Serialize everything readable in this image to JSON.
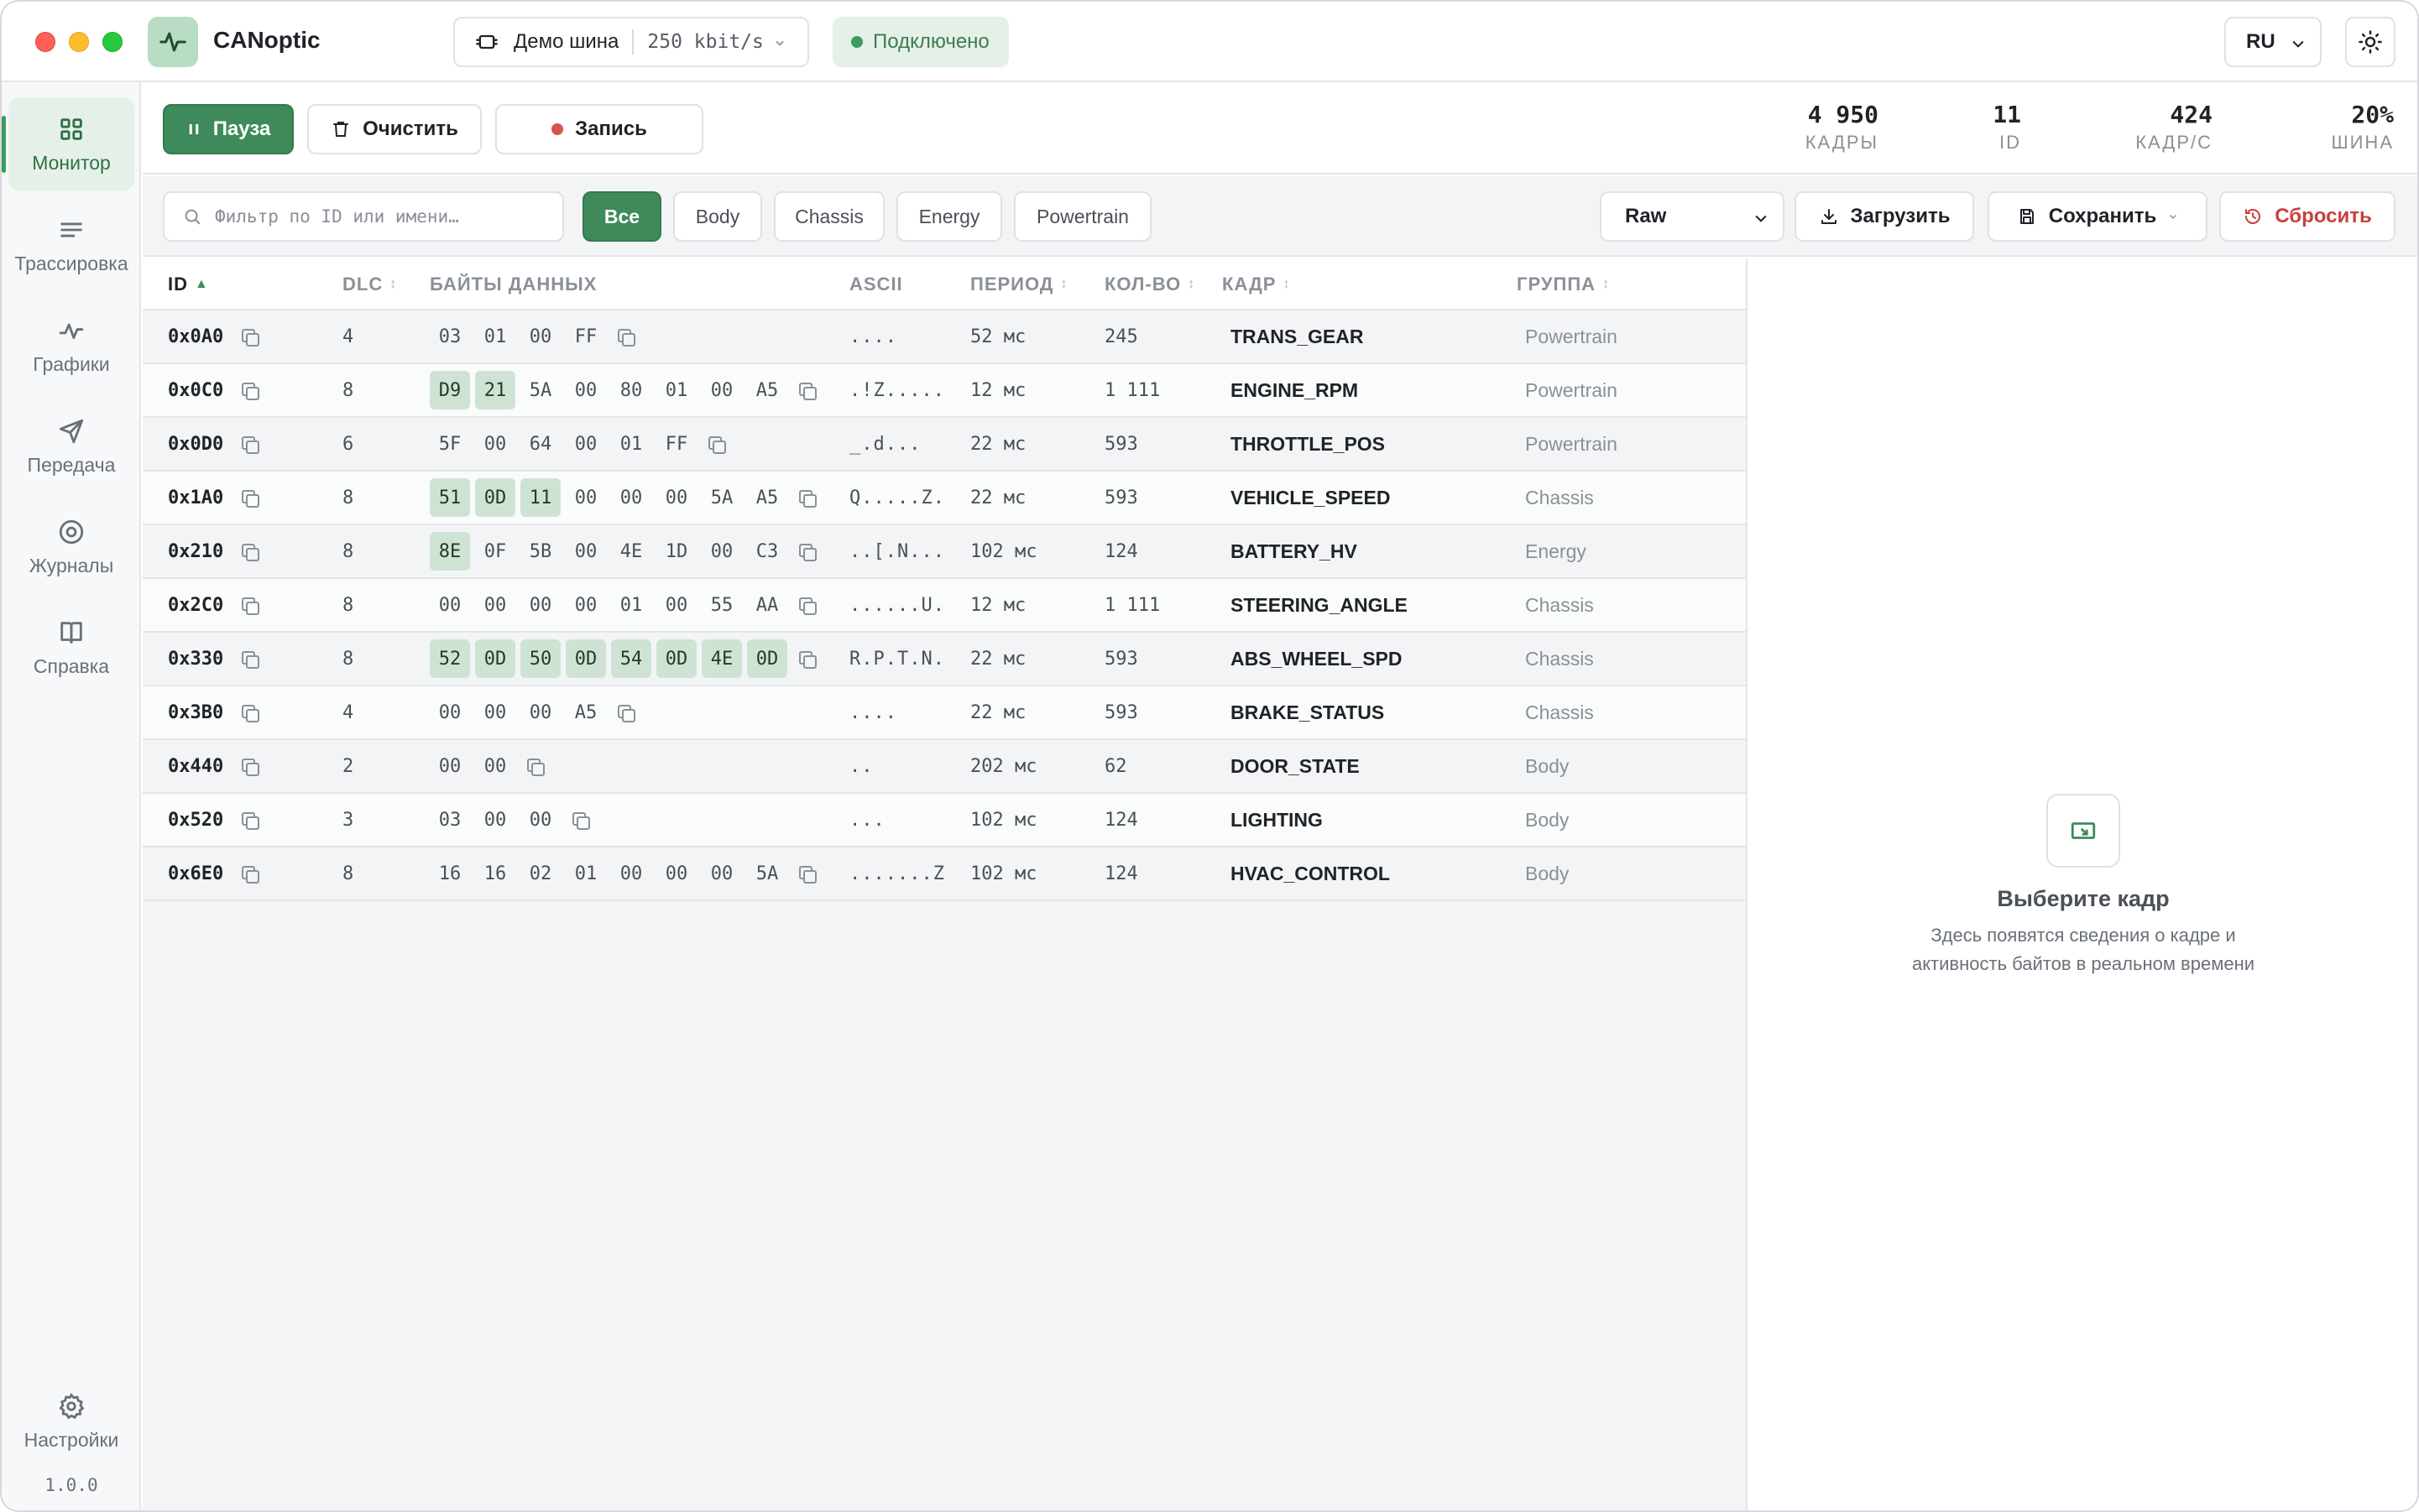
{
  "app": {
    "title": "CANoptic",
    "version": "1.0.0"
  },
  "bus": {
    "name": "Демо шина",
    "bitrate": "250 kbit/s"
  },
  "connection": {
    "status": "Подключено",
    "color": "#3f9a5e"
  },
  "language": "RU",
  "nav": {
    "items": [
      {
        "label": "Монитор",
        "icon": "grid-icon",
        "active": true
      },
      {
        "label": "Трассировка",
        "icon": "list-lines-icon"
      },
      {
        "label": "Графики",
        "icon": "pulse-icon"
      },
      {
        "label": "Передача",
        "icon": "send-icon"
      },
      {
        "label": "Журналы",
        "icon": "record-circle-icon"
      },
      {
        "label": "Справка",
        "icon": "book-icon"
      }
    ],
    "settings_label": "Настройки"
  },
  "toolbar": {
    "pause_label": "Пауза",
    "clear_label": "Очистить",
    "record_label": "Запись"
  },
  "stats": [
    {
      "value": "4 950",
      "label": "КАДРЫ"
    },
    {
      "value": "11",
      "label": "ID"
    },
    {
      "value": "424",
      "label": "КАДР/С"
    },
    {
      "value": "20%",
      "label": "ШИНА"
    }
  ],
  "filter": {
    "placeholder": "Фильтр по ID или имени…",
    "chips": [
      "Все",
      "Body",
      "Chassis",
      "Energy",
      "Powertrain"
    ],
    "active_chip": "Все",
    "mode": "Raw",
    "load_label": "Загрузить",
    "save_label": "Сохранить",
    "reset_label": "Сбросить"
  },
  "table": {
    "columns": {
      "id": "ID",
      "dlc": "DLC",
      "bytes": "БАЙТЫ ДАННЫХ",
      "ascii": "ASCII",
      "period": "ПЕРИОД",
      "count": "КОЛ-ВО",
      "frame": "КАДР",
      "group": "ГРУППА"
    },
    "sort": {
      "column": "ID",
      "direction": "asc"
    },
    "rows": [
      {
        "id": "0x0A0",
        "dlc": "4",
        "bytes": [
          "03",
          "01",
          "00",
          "FF"
        ],
        "changed": [],
        "ascii": "....",
        "period": "52 мс",
        "count": "245",
        "frame": "TRANS_GEAR",
        "group": "Powertrain"
      },
      {
        "id": "0x0C0",
        "dlc": "8",
        "bytes": [
          "D9",
          "21",
          "5A",
          "00",
          "80",
          "01",
          "00",
          "A5"
        ],
        "changed": [
          0,
          1
        ],
        "ascii": ".!Z.....",
        "period": "12 мс",
        "count": "1 111",
        "frame": "ENGINE_RPM",
        "group": "Powertrain"
      },
      {
        "id": "0x0D0",
        "dlc": "6",
        "bytes": [
          "5F",
          "00",
          "64",
          "00",
          "01",
          "FF"
        ],
        "changed": [],
        "ascii": "_.d...",
        "period": "22 мс",
        "count": "593",
        "frame": "THROTTLE_POS",
        "group": "Powertrain"
      },
      {
        "id": "0x1A0",
        "dlc": "8",
        "bytes": [
          "51",
          "0D",
          "11",
          "00",
          "00",
          "00",
          "5A",
          "A5"
        ],
        "changed": [
          0,
          1,
          2
        ],
        "ascii": "Q.....Z.",
        "period": "22 мс",
        "count": "593",
        "frame": "VEHICLE_SPEED",
        "group": "Chassis"
      },
      {
        "id": "0x210",
        "dlc": "8",
        "bytes": [
          "8E",
          "0F",
          "5B",
          "00",
          "4E",
          "1D",
          "00",
          "C3"
        ],
        "changed": [
          0
        ],
        "ascii": "..[.N...",
        "period": "102 мс",
        "count": "124",
        "frame": "BATTERY_HV",
        "group": "Energy"
      },
      {
        "id": "0x2C0",
        "dlc": "8",
        "bytes": [
          "00",
          "00",
          "00",
          "00",
          "01",
          "00",
          "55",
          "AA"
        ],
        "changed": [],
        "ascii": "......U.",
        "period": "12 мс",
        "count": "1 111",
        "frame": "STEERING_ANGLE",
        "group": "Chassis"
      },
      {
        "id": "0x330",
        "dlc": "8",
        "bytes": [
          "52",
          "0D",
          "50",
          "0D",
          "54",
          "0D",
          "4E",
          "0D"
        ],
        "changed": [
          0,
          1,
          2,
          3,
          4,
          5,
          6,
          7
        ],
        "ascii": "R.P.T.N.",
        "period": "22 мс",
        "count": "593",
        "frame": "ABS_WHEEL_SPD",
        "group": "Chassis"
      },
      {
        "id": "0x3B0",
        "dlc": "4",
        "bytes": [
          "00",
          "00",
          "00",
          "A5"
        ],
        "changed": [],
        "ascii": "....",
        "period": "22 мс",
        "count": "593",
        "frame": "BRAKE_STATUS",
        "group": "Chassis"
      },
      {
        "id": "0x440",
        "dlc": "2",
        "bytes": [
          "00",
          "00"
        ],
        "changed": [],
        "ascii": "..",
        "period": "202 мс",
        "count": "62",
        "frame": "DOOR_STATE",
        "group": "Body"
      },
      {
        "id": "0x520",
        "dlc": "3",
        "bytes": [
          "03",
          "00",
          "00"
        ],
        "changed": [],
        "ascii": "...",
        "period": "102 мс",
        "count": "124",
        "frame": "LIGHTING",
        "group": "Body"
      },
      {
        "id": "0x6E0",
        "dlc": "8",
        "bytes": [
          "16",
          "16",
          "02",
          "01",
          "00",
          "00",
          "00",
          "5A"
        ],
        "changed": [],
        "ascii": ".......Z",
        "period": "102 мс",
        "count": "124",
        "frame": "HVAC_CONTROL",
        "group": "Body"
      }
    ]
  },
  "detail": {
    "empty_title": "Выберите кадр",
    "empty_line1": "Здесь появятся сведения о кадре и",
    "empty_line2": "активность байтов в реальном времени"
  },
  "colors": {
    "accent": "#3f8a5a",
    "accent_light": "#e5f1e8",
    "byte_highlight": "#cfe3d5",
    "danger": "#c9403b"
  }
}
